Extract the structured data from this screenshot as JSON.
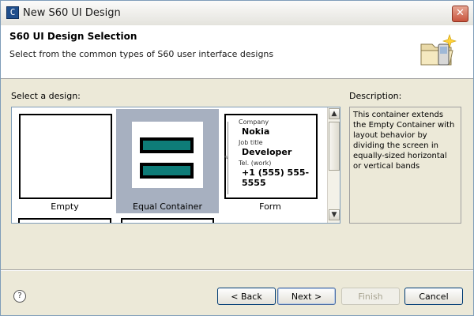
{
  "window": {
    "title": "New S60 UI Design",
    "close_label": "✕"
  },
  "header": {
    "title": "S60 UI Design Selection",
    "description": "Select from the common types of S60 user interface designs"
  },
  "gallery": {
    "label": "Select a design:",
    "tiles": [
      {
        "caption": "Empty"
      },
      {
        "caption": "Equal Container"
      },
      {
        "caption": "Form",
        "fields": [
          {
            "label": "Company",
            "value": "Nokia"
          },
          {
            "label": "Job title",
            "value": "Developer"
          },
          {
            "label": "Tel. (work)",
            "value": "+1 (555) 555-5555"
          }
        ]
      }
    ]
  },
  "description": {
    "label": "Description:",
    "text": "This container extends the Empty Container with layout behavior by dividing the screen in equally-sized horizontal or vertical bands"
  },
  "buttons": {
    "help": "?",
    "back": "< Back",
    "next": "Next >",
    "finish": "Finish",
    "cancel": "Cancel"
  },
  "colors": {
    "band": "#0e7c78",
    "selected_tile": "#a7b0c0"
  }
}
